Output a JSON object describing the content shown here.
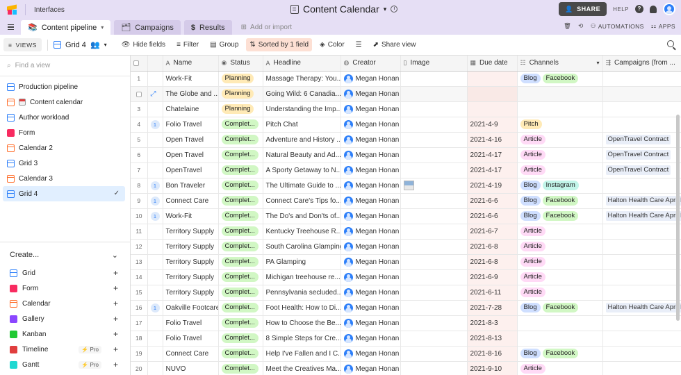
{
  "topbar": {
    "interfaces_label": "Interfaces",
    "base_title": "Content Calendar",
    "share_label": "SHARE",
    "help_label": "HELP"
  },
  "tabs": {
    "items": [
      {
        "label": "Content pipeline",
        "active": true
      },
      {
        "label": "Campaigns",
        "active": false
      },
      {
        "label": "Results",
        "active": false
      }
    ],
    "add_import_label": "Add or import",
    "automations_label": "AUTOMATIONS",
    "apps_label": "APPS"
  },
  "toolbar": {
    "views_label": "VIEWS",
    "view_name": "Grid 4",
    "hide_fields": "Hide fields",
    "filter": "Filter",
    "group": "Group",
    "sorted": "Sorted by 1 field",
    "color": "Color",
    "share_view": "Share view"
  },
  "sidebar": {
    "find_placeholder": "Find a view",
    "views": [
      {
        "label": "Production pipeline",
        "icon": "grid"
      },
      {
        "label": "Content calendar",
        "icon": "calendar"
      },
      {
        "label": "Author workload",
        "icon": "grid"
      },
      {
        "label": "Form",
        "icon": "form"
      },
      {
        "label": "Calendar 2",
        "icon": "calendar"
      },
      {
        "label": "Grid 3",
        "icon": "grid"
      },
      {
        "label": "Calendar 3",
        "icon": "calendar"
      },
      {
        "label": "Grid 4",
        "icon": "grid",
        "selected": true
      }
    ],
    "create_label": "Create...",
    "create_items": [
      {
        "label": "Grid",
        "icon": "grid"
      },
      {
        "label": "Form",
        "icon": "form"
      },
      {
        "label": "Calendar",
        "icon": "calendar"
      },
      {
        "label": "Gallery",
        "icon": "gallery"
      },
      {
        "label": "Kanban",
        "icon": "kanban"
      },
      {
        "label": "Timeline",
        "icon": "timeline",
        "pro": "Pro"
      },
      {
        "label": "Gantt",
        "icon": "gantt",
        "pro": "Pro"
      }
    ]
  },
  "grid": {
    "columns": [
      "Name",
      "Status",
      "Headline",
      "Creator",
      "Image",
      "Due date",
      "Channels",
      "Campaigns (from ..."
    ],
    "rows": [
      {
        "n": "1",
        "c": "",
        "name": "Work-Fit",
        "status": "Planning",
        "headline": "Massage Therapy: You...",
        "creator": "Megan Honan",
        "img": false,
        "due": "",
        "channels": [
          "Blog",
          "Facebook"
        ],
        "campaign": ""
      },
      {
        "n": "",
        "c": "",
        "name": "The Globe and ...",
        "status": "Planning",
        "headline": "Going Wild: 6 Canadia...",
        "creator": "Megan Honan",
        "img": false,
        "due": "",
        "channels": [],
        "campaign": "",
        "hl": true
      },
      {
        "n": "3",
        "c": "",
        "name": "Chatelaine",
        "status": "Planning",
        "headline": "Understanding the Imp...",
        "creator": "Megan Honan",
        "img": false,
        "due": "",
        "channels": [],
        "campaign": ""
      },
      {
        "n": "4",
        "c": "1",
        "name": "Folio Travel",
        "status": "Complet...",
        "headline": "Pitch Chat",
        "creator": "Megan Honan",
        "img": false,
        "due": "2021-4-9",
        "channels": [
          "Pitch"
        ],
        "campaign": ""
      },
      {
        "n": "5",
        "c": "",
        "name": "Open Travel",
        "status": "Complet...",
        "headline": "Adventure and History ...",
        "creator": "Megan Honan",
        "img": false,
        "due": "2021-4-16",
        "channels": [
          "Article"
        ],
        "campaign": "OpenTravel Contract"
      },
      {
        "n": "6",
        "c": "",
        "name": "Open Travel",
        "status": "Complet...",
        "headline": "Natural Beauty and Ad...",
        "creator": "Megan Honan",
        "img": false,
        "due": "2021-4-17",
        "channels": [
          "Article"
        ],
        "campaign": "OpenTravel Contract"
      },
      {
        "n": "7",
        "c": "",
        "name": "OpenTravel",
        "status": "Complet...",
        "headline": "A Sporty Getaway to N...",
        "creator": "Megan Honan",
        "img": false,
        "due": "2021-4-17",
        "channels": [
          "Article"
        ],
        "campaign": "OpenTravel Contract"
      },
      {
        "n": "8",
        "c": "1",
        "name": "Bon Traveler",
        "status": "Complet...",
        "headline": "The Ultimate Guide to ...",
        "creator": "Megan Honan",
        "img": true,
        "due": "2021-4-19",
        "channels": [
          "Blog",
          "Instagram"
        ],
        "campaign": ""
      },
      {
        "n": "9",
        "c": "1",
        "name": "Connect Care",
        "status": "Complet...",
        "headline": "Connect Care's Tips fo...",
        "creator": "Megan Honan",
        "img": false,
        "due": "2021-6-6",
        "channels": [
          "Blog",
          "Facebook"
        ],
        "campaign": "Halton Health Care April E"
      },
      {
        "n": "10",
        "c": "1",
        "name": "Work-Fit",
        "status": "Complet...",
        "headline": "The Do's and Don'ts of...",
        "creator": "Megan Honan",
        "img": false,
        "due": "2021-6-6",
        "channels": [
          "Blog",
          "Facebook"
        ],
        "campaign": "Halton Health Care April E"
      },
      {
        "n": "11",
        "c": "",
        "name": "Territory Supply",
        "status": "Complet...",
        "headline": "Kentucky Treehouse R...",
        "creator": "Megan Honan",
        "img": false,
        "due": "2021-6-7",
        "channels": [
          "Article"
        ],
        "campaign": ""
      },
      {
        "n": "12",
        "c": "",
        "name": "Territory Supply",
        "status": "Complet...",
        "headline": "South Carolina Glamping",
        "creator": "Megan Honan",
        "img": false,
        "due": "2021-6-8",
        "channels": [
          "Article"
        ],
        "campaign": ""
      },
      {
        "n": "13",
        "c": "",
        "name": "Territory Supply",
        "status": "Complet...",
        "headline": "PA Glamping",
        "creator": "Megan Honan",
        "img": false,
        "due": "2021-6-8",
        "channels": [
          "Article"
        ],
        "campaign": ""
      },
      {
        "n": "14",
        "c": "",
        "name": "Territory Supply",
        "status": "Complet...",
        "headline": "Michigan treehouse re...",
        "creator": "Megan Honan",
        "img": false,
        "due": "2021-6-9",
        "channels": [
          "Article"
        ],
        "campaign": ""
      },
      {
        "n": "15",
        "c": "",
        "name": "Territory Supply",
        "status": "Complet...",
        "headline": "Pennsylvania secluded...",
        "creator": "Megan Honan",
        "img": false,
        "due": "2021-6-11",
        "channels": [
          "Article"
        ],
        "campaign": ""
      },
      {
        "n": "16",
        "c": "1",
        "name": "Oakville Footcare",
        "status": "Complet...",
        "headline": "Foot Health: How to Di...",
        "creator": "Megan Honan",
        "img": false,
        "due": "2021-7-28",
        "channels": [
          "Blog",
          "Facebook"
        ],
        "campaign": "Halton Health Care April E"
      },
      {
        "n": "17",
        "c": "",
        "name": "Folio Travel",
        "status": "Complet...",
        "headline": "How to Choose the Be...",
        "creator": "Megan Honan",
        "img": false,
        "due": "2021-8-3",
        "channels": [],
        "campaign": ""
      },
      {
        "n": "18",
        "c": "",
        "name": "Folio Travel",
        "status": "Complet...",
        "headline": "8 Simple Steps for Cre...",
        "creator": "Megan Honan",
        "img": false,
        "due": "2021-8-13",
        "channels": [],
        "campaign": ""
      },
      {
        "n": "19",
        "c": "",
        "name": "Connect Care",
        "status": "Complet...",
        "headline": "Help I've Fallen and I C...",
        "creator": "Megan Honan",
        "img": false,
        "due": "2021-8-16",
        "channels": [
          "Blog",
          "Facebook"
        ],
        "campaign": ""
      },
      {
        "n": "20",
        "c": "",
        "name": "NUVO",
        "status": "Complet...",
        "headline": "Meet the Creatives Ma...",
        "creator": "Megan Honan",
        "img": false,
        "due": "2021-9-10",
        "channels": [
          "Article"
        ],
        "campaign": ""
      }
    ]
  }
}
